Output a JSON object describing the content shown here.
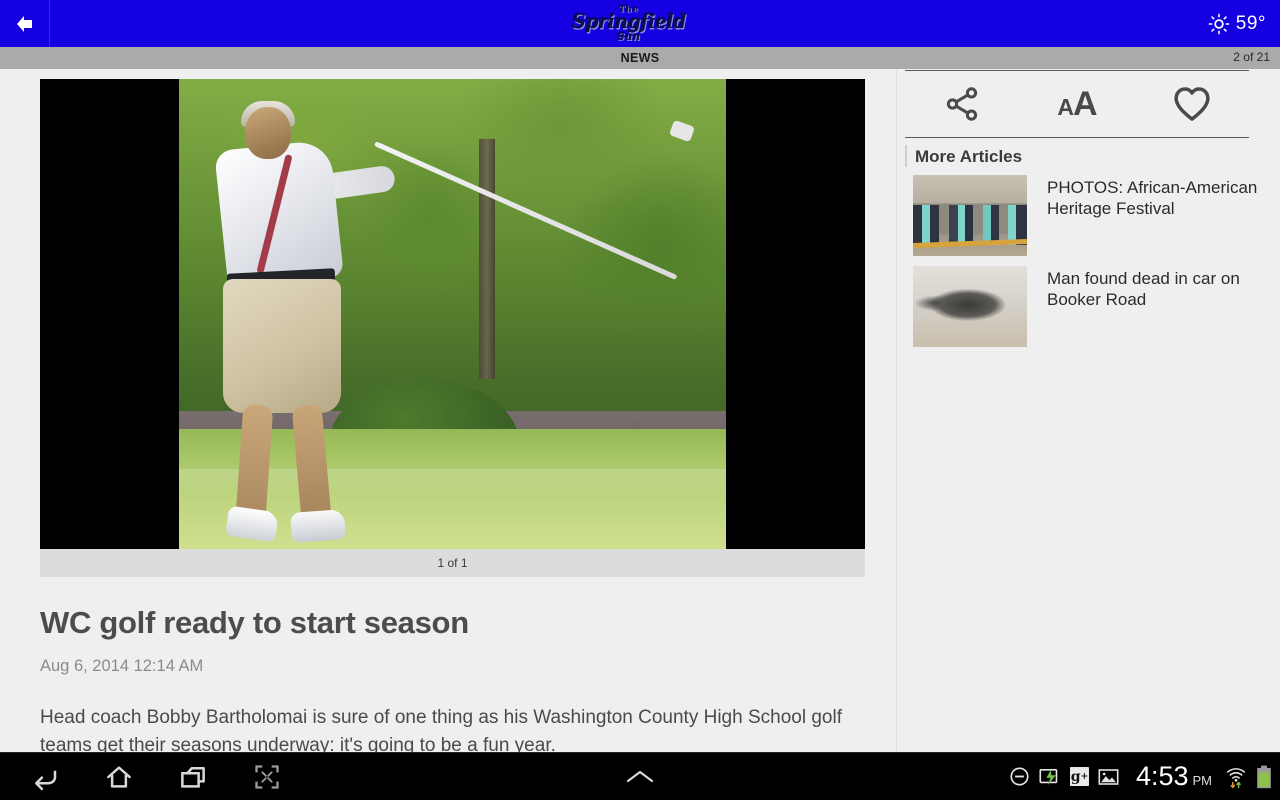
{
  "header": {
    "back_icon": "back-arrow-icon",
    "brand_the": "The",
    "brand_name": "Springfield",
    "brand_sun": "Sun",
    "weather_icon": "sun-icon",
    "temperature": "59°"
  },
  "section_bar": {
    "title": "NEWS",
    "counter": "2 of 21"
  },
  "article": {
    "photo_caption": "1 of 1",
    "headline": "WC golf ready to start season",
    "byline": "Aug 6, 2014 12:14 AM",
    "body": "Head coach Bobby Bartholomai is sure of one thing as his Washington County High School golf teams get their seasons underway: it's going to be a fun year."
  },
  "sidebar": {
    "tools": [
      {
        "name": "share-button",
        "icon": "share-icon",
        "label": ""
      },
      {
        "name": "text-size-button",
        "icon": "text-size-icon",
        "small": "A",
        "big": "A"
      },
      {
        "name": "favorite-button",
        "icon": "heart-icon",
        "label": ""
      }
    ],
    "more_heading": "More Articles",
    "more_articles": [
      {
        "title": "PHOTOS: African-American Heritage Festival",
        "thumb": "festival-parade-thumbnail"
      },
      {
        "title": "Man found dead in car on Booker Road",
        "thumb": "pothole-road-thumbnail"
      }
    ]
  },
  "navbar": {
    "buttons": [
      {
        "name": "back-button",
        "icon": "back-icon"
      },
      {
        "name": "home-button",
        "icon": "home-icon"
      },
      {
        "name": "recent-apps-button",
        "icon": "recent-apps-icon"
      },
      {
        "name": "screenshot-button",
        "icon": "screenshot-icon"
      }
    ],
    "center_icon": "chevron-up-icon",
    "tray": {
      "dnd_icon": "do-not-disturb-icon",
      "cast_icon": "cast-screen-icon",
      "gplus_icon": "g",
      "gplus_superscript": "+",
      "screenshot_icon": "image-icon",
      "time": "4:53",
      "ampm": "PM",
      "wifi_icon": "wifi-icon",
      "data_icon": "data-transfer-icon",
      "battery_icon": "battery-icon"
    }
  },
  "colors": {
    "header_blue": "#1400e0",
    "section_gray": "#aaaaaa",
    "page_bg": "#efefef",
    "caption_bg": "#dcdcdc",
    "navbar_black": "#000000",
    "battery_green": "#8bc34a"
  }
}
